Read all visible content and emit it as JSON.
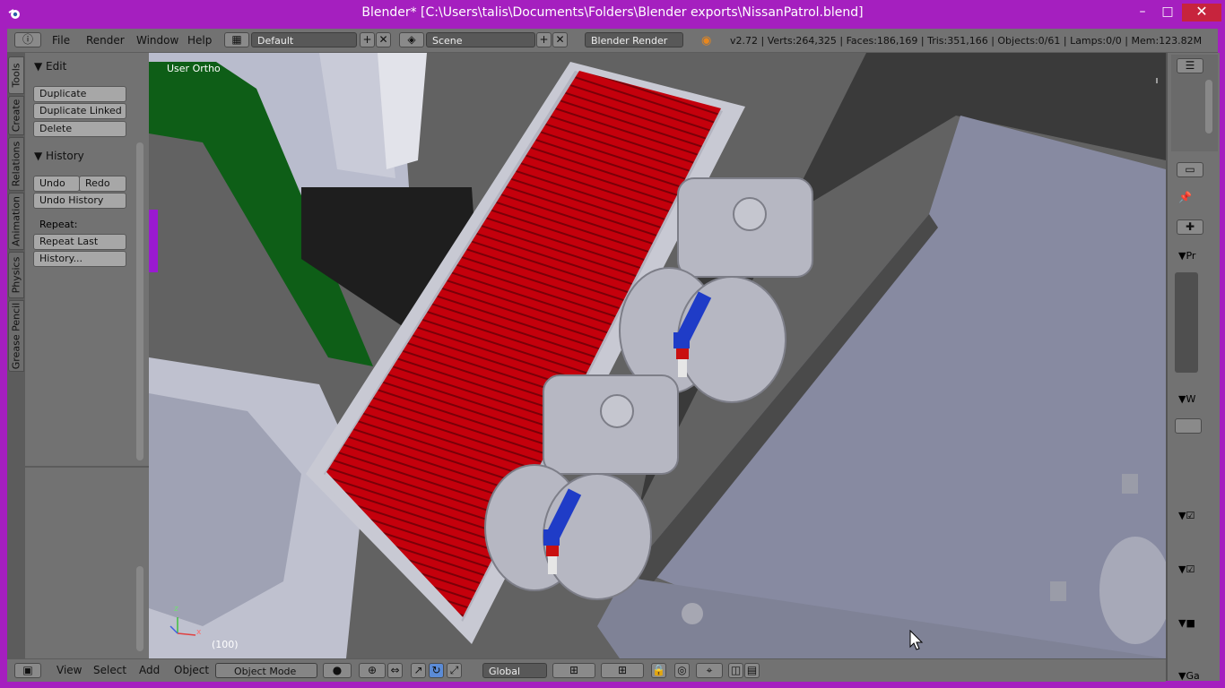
{
  "window": {
    "title": "Blender* [C:\\Users\\talis\\Documents\\Folders\\Blender exports\\NissanPatrol.blend]",
    "minimize": "–",
    "maximize": "□",
    "close": "✕"
  },
  "header": {
    "menus": [
      "File",
      "Render",
      "Window",
      "Help"
    ],
    "layout": "Default",
    "scene": "Scene",
    "engine": "Blender Render",
    "stats": "v2.72 | Verts:264,325 | Faces:186,169 | Tris:351,166 | Objects:0/61 | Lamps:0/0 | Mem:123.82M"
  },
  "tabs": [
    "Tools",
    "Create",
    "Relations",
    "Animation",
    "Physics",
    "Grease Pencil"
  ],
  "edit_panel": {
    "title": "Edit",
    "buttons": [
      "Duplicate",
      "Duplicate Linked",
      "Delete"
    ]
  },
  "history_panel": {
    "title": "History",
    "undo": "Undo",
    "redo": "Redo",
    "undo_history": "Undo History",
    "repeat_label": "Repeat:",
    "repeat_last": "Repeat Last",
    "history": "History..."
  },
  "viewport": {
    "view_label": "User Ortho",
    "frame": "(100)",
    "axis_z": "z",
    "axis_x": "x"
  },
  "footer": {
    "menus": [
      "View",
      "Select",
      "Add",
      "Object"
    ],
    "mode": "Object Mode",
    "orientation": "Global"
  },
  "props": {
    "panel1": "Pr",
    "panel2": "W",
    "panel3": "Ga"
  },
  "colors": {
    "titlebar": "#a51fbf",
    "grille": "#c4000c",
    "hose": "#1f3cc7"
  }
}
